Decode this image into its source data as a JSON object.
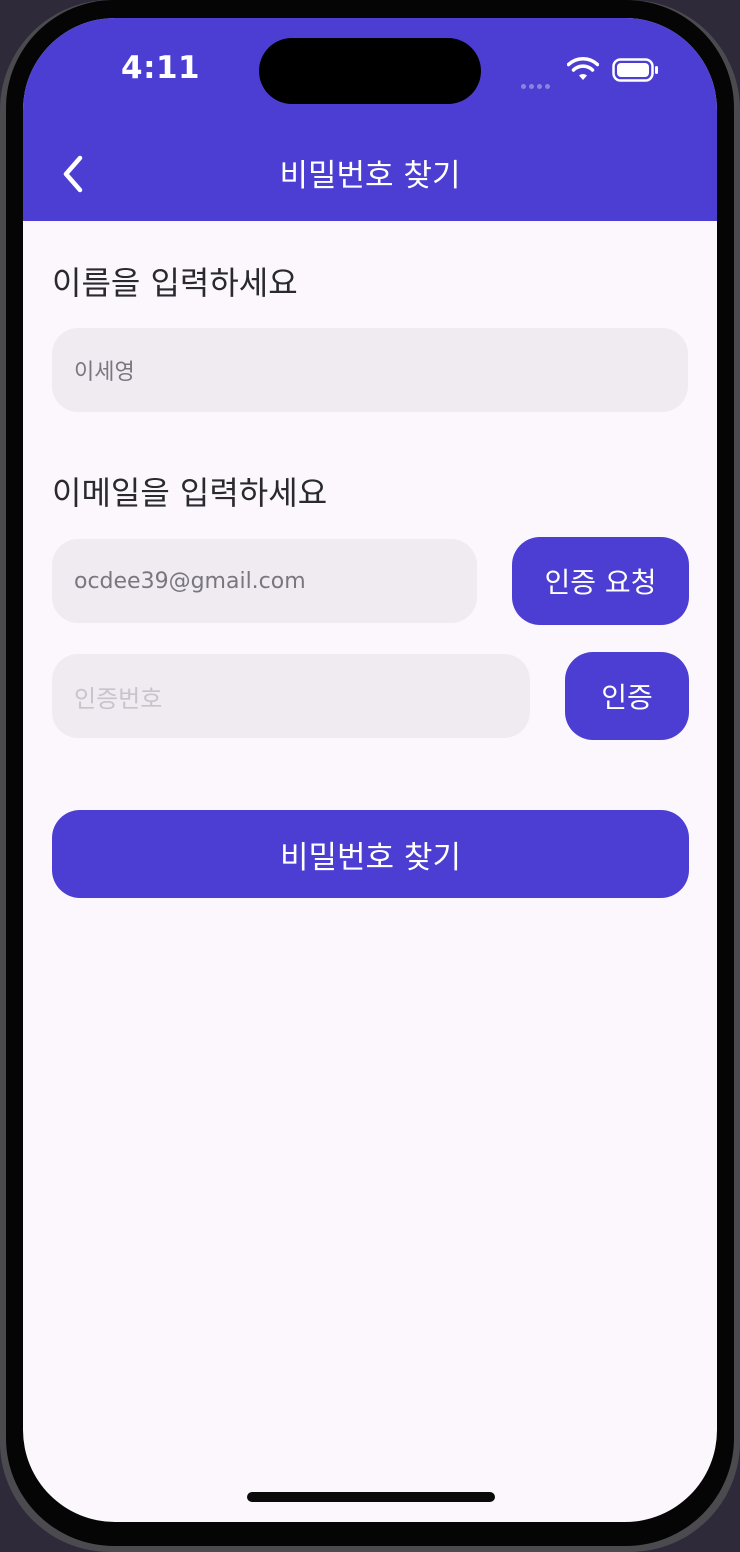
{
  "status_bar": {
    "time": "4:11"
  },
  "header": {
    "title": "비밀번호 찾기"
  },
  "name_section": {
    "label": "이름을 입력하세요",
    "value": "이세영"
  },
  "email_section": {
    "label": "이메일을 입력하세요",
    "email_value": "ocdee39@gmail.com",
    "request_button": "인증 요청",
    "code_placeholder": "인증번호",
    "verify_button": "인증"
  },
  "submit_button": "비밀번호 찾기",
  "colors": {
    "primary": "#4c3ed3",
    "field_bg": "#efebf1",
    "page_bg": "#fbf7fd"
  },
  "icons": [
    "back-chevron-icon",
    "wifi-icon",
    "battery-icon",
    "cellular-signal-icon"
  ]
}
